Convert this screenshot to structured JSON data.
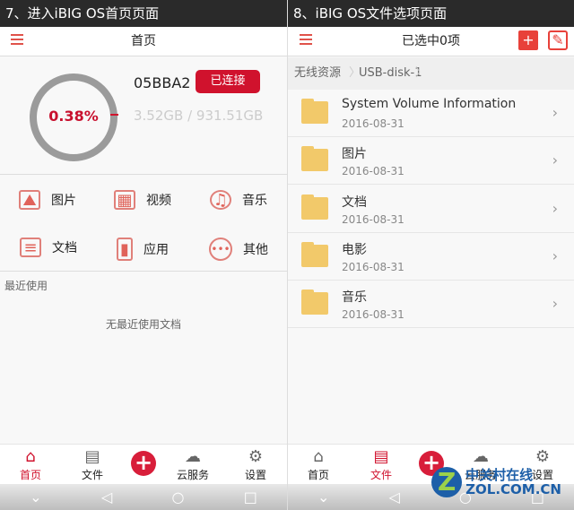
{
  "left": {
    "caption": "7、进入iBIG OS首页页面",
    "header_title": "首页",
    "storage": {
      "percent_label": "0.38%",
      "percent": 0.38,
      "device_name": "05BBA2",
      "status_button": "已连接",
      "capacity": "3.52GB / 931.51GB"
    },
    "categories": [
      {
        "label": "图片",
        "icon": "image-icon"
      },
      {
        "label": "视频",
        "icon": "film-icon"
      },
      {
        "label": "音乐",
        "icon": "music-icon"
      },
      {
        "label": "文档",
        "icon": "document-icon"
      },
      {
        "label": "应用",
        "icon": "phone-app-icon"
      },
      {
        "label": "其他",
        "icon": "more-icon"
      }
    ],
    "recent_title": "最近使用",
    "recent_empty": "无最近使用文档",
    "nav": [
      "首页",
      "文件",
      "云服务",
      "设置"
    ]
  },
  "right": {
    "caption": "8、iBIG OS文件选项页面",
    "header_title": "已选中0项",
    "breadcrumb": [
      "无线资源",
      "USB-disk-1"
    ],
    "files": [
      {
        "name": "System Volume Information",
        "date": "2016-08-31"
      },
      {
        "name": "图片",
        "date": "2016-08-31"
      },
      {
        "name": "文档",
        "date": "2016-08-31"
      },
      {
        "name": "电影",
        "date": "2016-08-31"
      },
      {
        "name": "音乐",
        "date": "2016-08-31"
      }
    ],
    "nav": [
      "首页",
      "文件",
      "云服务",
      "设置"
    ]
  },
  "watermark": {
    "line1": "中关村在线",
    "line2": "ZOL.COM.CN"
  },
  "colors": {
    "accent": "#d0122d",
    "folder": "#f2c96a"
  }
}
